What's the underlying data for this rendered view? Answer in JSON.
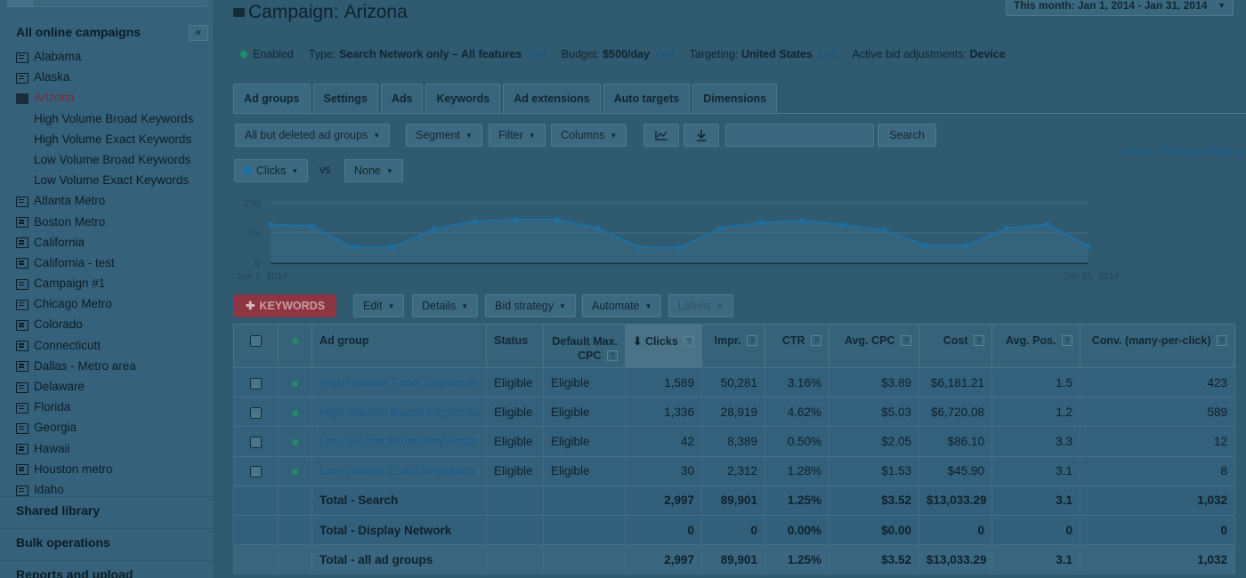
{
  "sidebar": {
    "heading": "All online campaigns",
    "collapse_label": "«",
    "items": [
      {
        "label": "Alabama",
        "type": "campaign"
      },
      {
        "label": "Alaska",
        "type": "campaign"
      },
      {
        "label": "Arizona",
        "type": "campaign-open"
      },
      {
        "label": "High Volume Broad Keywords",
        "type": "adgroup"
      },
      {
        "label": "High Volume Exact Keywords",
        "type": "adgroup"
      },
      {
        "label": "Low Volume Broad Keywords",
        "type": "adgroup"
      },
      {
        "label": "Low Volume Exact Keywords",
        "type": "adgroup"
      },
      {
        "label": "Atlanta Metro",
        "type": "campaign"
      },
      {
        "label": "Boston Metro",
        "type": "campaign"
      },
      {
        "label": "California",
        "type": "campaign"
      },
      {
        "label": "California - test",
        "type": "campaign"
      },
      {
        "label": "Campaign #1",
        "type": "campaign"
      },
      {
        "label": "Chicago Metro",
        "type": "campaign"
      },
      {
        "label": "Colorado",
        "type": "campaign"
      },
      {
        "label": "Connecticutt",
        "type": "campaign"
      },
      {
        "label": "Dallas - Metro area",
        "type": "campaign"
      },
      {
        "label": "Delaware",
        "type": "campaign"
      },
      {
        "label": "Florida",
        "type": "campaign"
      },
      {
        "label": "Georgia",
        "type": "campaign"
      },
      {
        "label": "Hawaii",
        "type": "campaign"
      },
      {
        "label": "Houston metro",
        "type": "campaign"
      },
      {
        "label": "Idaho",
        "type": "campaign"
      }
    ],
    "shared_library": "Shared library",
    "bulk_operations": "Bulk operations",
    "reports": "Reports and upload"
  },
  "header": {
    "title_prefix": "Campaign:",
    "title_name": "Arizona",
    "date_range": "This month: Jan 1, 2014 - Jan 31, 2014"
  },
  "status": {
    "enabled": "Enabled",
    "type_label": "Type:",
    "type_value": "Search Network only – All features",
    "budget_label": "Budget:",
    "budget_value": "$500/day",
    "targeting_label": "Targeting:",
    "targeting_value": "United States",
    "bid_label": "Active bid adjustments:",
    "bid_value": "Device",
    "edit": "Edit"
  },
  "tabs": [
    "Ad groups",
    "Settings",
    "Ads",
    "Keywords",
    "Ad extensions",
    "Auto targets",
    "Dimensions"
  ],
  "toolbar": {
    "filter_state": "All but deleted ad groups",
    "segment": "Segment",
    "filter": "Filter",
    "columns": "Columns",
    "search_button": "Search",
    "search_placeholder": "",
    "view_history": "View Change History"
  },
  "chart_controls": {
    "metric1": "Clicks",
    "vs": "vs",
    "metric2": "None"
  },
  "chart_data": {
    "type": "line",
    "series": [
      {
        "name": "Clicks",
        "values": [
          96,
          92,
          40,
          40,
          85,
          104,
          108,
          108,
          87,
          40,
          38,
          87,
          101,
          106,
          95,
          82,
          45,
          44,
          87,
          96,
          42
        ]
      }
    ],
    "yticks": [
      150,
      75,
      0
    ],
    "ylim": [
      0,
      150
    ],
    "x_start_label": "Jan 1, 2014",
    "x_end_label": "Jan 31, 2014",
    "color": "#1c6fa3"
  },
  "actions": {
    "add_keywords": "KEYWORDS",
    "edit": "Edit",
    "details": "Details",
    "bid_strategy": "Bid strategy",
    "automate": "Automate",
    "labels": "Labels"
  },
  "table": {
    "headers": {
      "ad_group": "Ad group",
      "status": "Status",
      "default_max_cpc": "Default Max. CPC",
      "clicks": "Clicks",
      "impr": "Impr.",
      "ctr": "CTR",
      "avg_cpc": "Avg. CPC",
      "cost": "Cost",
      "avg_pos": "Avg. Pos.",
      "conv": "Conv. (many-per-click)"
    },
    "rows": [
      {
        "name": "High Volume Exact Keywords",
        "status": "Eligible",
        "cpc": "Eligible",
        "clicks": "1,589",
        "impr": "50,281",
        "ctr": "3.16%",
        "avg_cpc": "$3.89",
        "cost": "$6,181.21",
        "pos": "1.5",
        "conv": "423"
      },
      {
        "name": "High Volume Broad Keywords",
        "status": "Eligible",
        "cpc": "Eligible",
        "clicks": "1,336",
        "impr": "28,919",
        "ctr": "4.62%",
        "avg_cpc": "$5.03",
        "cost": "$6,720.08",
        "pos": "1.2",
        "conv": "589"
      },
      {
        "name": "Low Volume Broad Keywords",
        "status": "Eligible",
        "cpc": "Eligible",
        "clicks": "42",
        "impr": "8,389",
        "ctr": "0.50%",
        "avg_cpc": "$2.05",
        "cost": "$86.10",
        "pos": "3.3",
        "conv": "12"
      },
      {
        "name": "Low Volume Exact Keywords",
        "status": "Eligible",
        "cpc": "Eligible",
        "clicks": "30",
        "impr": "2,312",
        "ctr": "1.28%",
        "avg_cpc": "$1.53",
        "cost": "$45.90",
        "pos": "3.1",
        "conv": "8"
      }
    ],
    "totals": [
      {
        "name": "Total - Search",
        "clicks": "2,997",
        "impr": "89,901",
        "ctr": "1.25%",
        "avg_cpc": "$3.52",
        "cost": "$13,033.29",
        "pos": "3.1",
        "conv": "1,032"
      },
      {
        "name": "Total - Display Network",
        "clicks": "0",
        "impr": "0",
        "ctr": "0.00%",
        "avg_cpc": "$0.00",
        "cost": "0",
        "pos": "0",
        "conv": "0"
      },
      {
        "name": "Total - all ad groups",
        "clicks": "2,997",
        "impr": "89,901",
        "ctr": "1.25%",
        "avg_cpc": "$3.52",
        "cost": "$13,033.29",
        "pos": "3.1",
        "conv": "1,032"
      }
    ]
  }
}
